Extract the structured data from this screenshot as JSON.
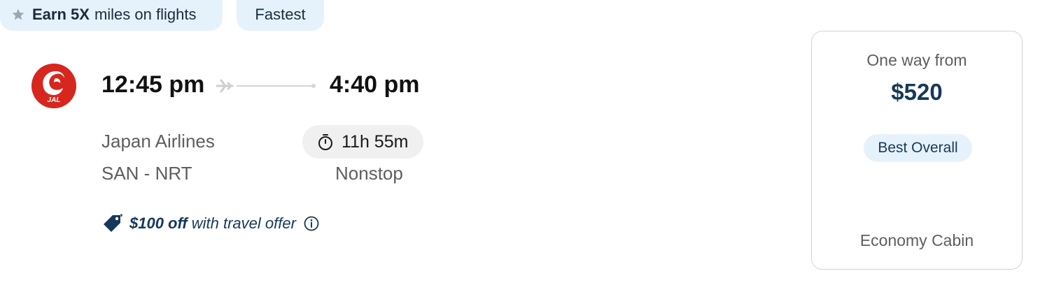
{
  "tags": {
    "miles": {
      "bold": "Earn 5X",
      "rest": "miles on flights",
      "icon": "star-icon"
    },
    "fastest": "Fastest"
  },
  "flight": {
    "departure_time": "12:45 pm",
    "arrival_time": "4:40 pm",
    "airline": "Japan Airlines",
    "route": "SAN - NRT",
    "duration": "11h 55m",
    "stops": "Nonstop",
    "logo_text": "JAL"
  },
  "offer": {
    "bold": "$100 off",
    "rest": "with travel offer"
  },
  "price": {
    "label": "One way from",
    "value": "$520",
    "badge": "Best Overall",
    "cabin": "Economy Cabin"
  },
  "colors": {
    "accent_dark": "#16385a",
    "tag_bg": "#e6f2fb",
    "brand_red": "#d7261e"
  }
}
